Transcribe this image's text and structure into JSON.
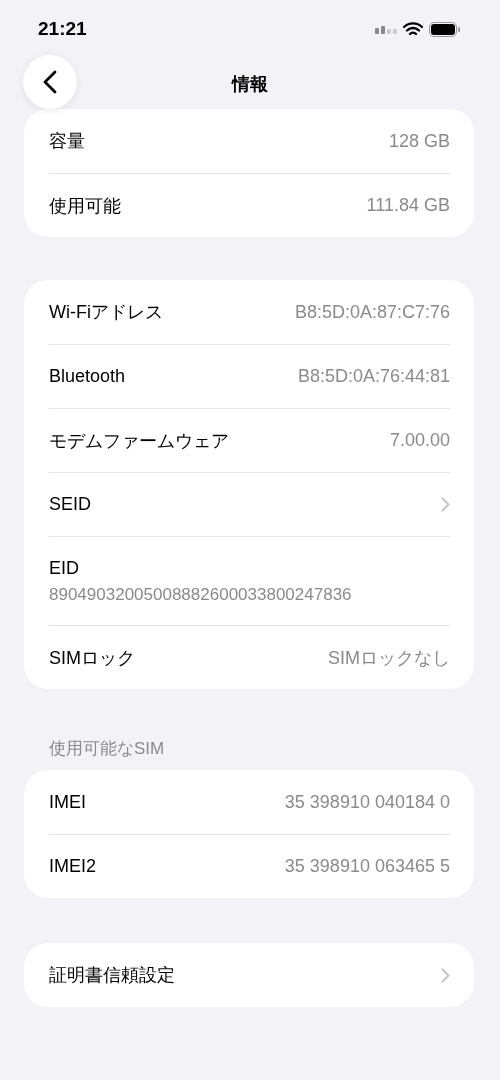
{
  "status_bar": {
    "time": "21:21"
  },
  "nav": {
    "title": "情報"
  },
  "groups": [
    {
      "rows": [
        {
          "kind": "value",
          "label": "容量",
          "value": "128 GB"
        },
        {
          "kind": "value",
          "label": "使用可能",
          "value": "111.84 GB"
        }
      ]
    },
    {
      "rows": [
        {
          "kind": "value",
          "label": "Wi-Fiアドレス",
          "value": "B8:5D:0A:87:C7:76"
        },
        {
          "kind": "value",
          "label": "Bluetooth",
          "value": "B8:5D:0A:76:44:81"
        },
        {
          "kind": "value",
          "label": "モデムファームウェア",
          "value": "7.00.00"
        },
        {
          "kind": "chevron",
          "label": "SEID"
        },
        {
          "kind": "stacked",
          "label": "EID",
          "value": "89049032005008882600033800247836"
        },
        {
          "kind": "value",
          "label": "SIMロック",
          "value": "SIMロックなし"
        }
      ]
    },
    {
      "header": "使用可能なSIM",
      "rows": [
        {
          "kind": "value",
          "label": "IMEI",
          "value": "35 398910 040184 0"
        },
        {
          "kind": "value",
          "label": "IMEI2",
          "value": "35 398910 063465 5"
        }
      ]
    },
    {
      "rows": [
        {
          "kind": "chevron",
          "label": "証明書信頼設定"
        }
      ]
    }
  ]
}
